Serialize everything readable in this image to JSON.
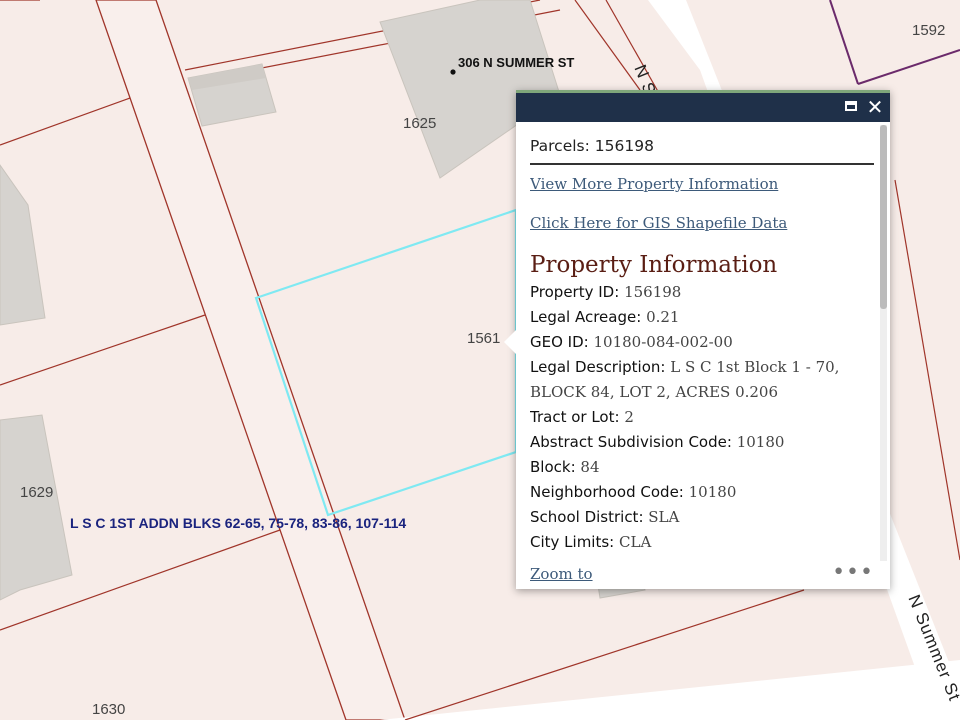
{
  "map": {
    "parcel_numbers": [
      "1592",
      "1625",
      "1561",
      "1629",
      "1630"
    ],
    "address_label": "306 N SUMMER ST",
    "subdivision_label": "L S C 1ST ADDN BLKS 62-65, 75-78, 83-86, 107-114",
    "street_labels": [
      "N Summer St",
      "N Summer St"
    ],
    "colors": {
      "background": "#f7ece8",
      "parcel_line": "#a0352a",
      "selection": "#7fe9f2",
      "building": "#d6d3cf",
      "road": "#ffffff"
    }
  },
  "popup": {
    "title_label": "Parcels:",
    "title_value": "156198",
    "links": {
      "more_info": "View More Property Information",
      "gis": "Click Here for GIS Shapefile Data"
    },
    "section_heading": "Property Information",
    "fields": [
      {
        "label": "Property ID:",
        "value": "156198"
      },
      {
        "label": "Legal Acreage:",
        "value": "0.21"
      },
      {
        "label": "GEO ID:",
        "value": "10180-084-002-00"
      },
      {
        "label": "Legal Description:",
        "value": "L S C 1st Block 1 - 70, BLOCK 84, LOT 2, ACRES 0.206"
      },
      {
        "label": "Tract or Lot:",
        "value": "2"
      },
      {
        "label": "Abstract Subdivision Code:",
        "value": "10180"
      },
      {
        "label": "Block:",
        "value": "84"
      },
      {
        "label": "Neighborhood Code:",
        "value": "10180"
      },
      {
        "label": "School District:",
        "value": "SLA"
      },
      {
        "label": "City Limits:",
        "value": "CLA"
      }
    ],
    "zoom_label": "Zoom to",
    "more_label": "•••",
    "header_icons": [
      "maximize-icon",
      "close-icon"
    ],
    "header_color": "#1f3049"
  }
}
